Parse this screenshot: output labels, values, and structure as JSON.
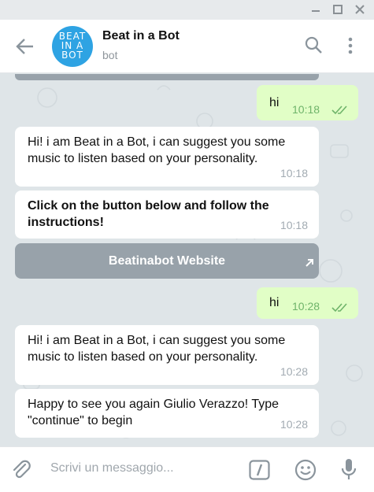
{
  "header": {
    "title": "Beat in a Bot",
    "subtitle": "bot",
    "avatar_text": [
      "BEAT",
      "IN A",
      "BOT"
    ]
  },
  "messages": [
    {
      "dir": "out",
      "text": "hi",
      "time": "10:18"
    },
    {
      "dir": "in",
      "text": "Hi! i am Beat in a Bot, i can suggest you some music to listen based on your personality.",
      "time": "10:18"
    },
    {
      "dir": "in",
      "text": "Click on the button below and follow the instructions!",
      "time": "10:18"
    },
    {
      "dir": "button",
      "text": "Beatinabot Website"
    },
    {
      "dir": "out",
      "text": "hi",
      "time": "10:28"
    },
    {
      "dir": "in",
      "text": "Hi! i am Beat in a Bot, i can suggest you some music to listen based on your personality.",
      "time": "10:28"
    },
    {
      "dir": "in",
      "text": "Happy to see you again Giulio Verazzo! Type \"continue\" to begin",
      "time": "10:28"
    }
  ],
  "composer": {
    "placeholder": "Scrivi un messaggio..."
  },
  "colors": {
    "chat_bg": "#dfe5e8",
    "outgoing_bubble": "#e1fec6",
    "incoming_bubble": "#ffffff",
    "inline_button": "#98a2aa",
    "avatar": "#2ea3e3",
    "read_ticks": "#6fb46a"
  },
  "icons": {
    "window": [
      "minimize-icon",
      "maximize-icon",
      "close-icon"
    ],
    "header": [
      "back-arrow-icon",
      "search-icon",
      "more-vertical-icon"
    ],
    "composer": [
      "paperclip-icon",
      "slash-commands-icon",
      "emoji-icon",
      "microphone-icon"
    ],
    "message": [
      "double-check-icon",
      "external-link-icon"
    ]
  }
}
